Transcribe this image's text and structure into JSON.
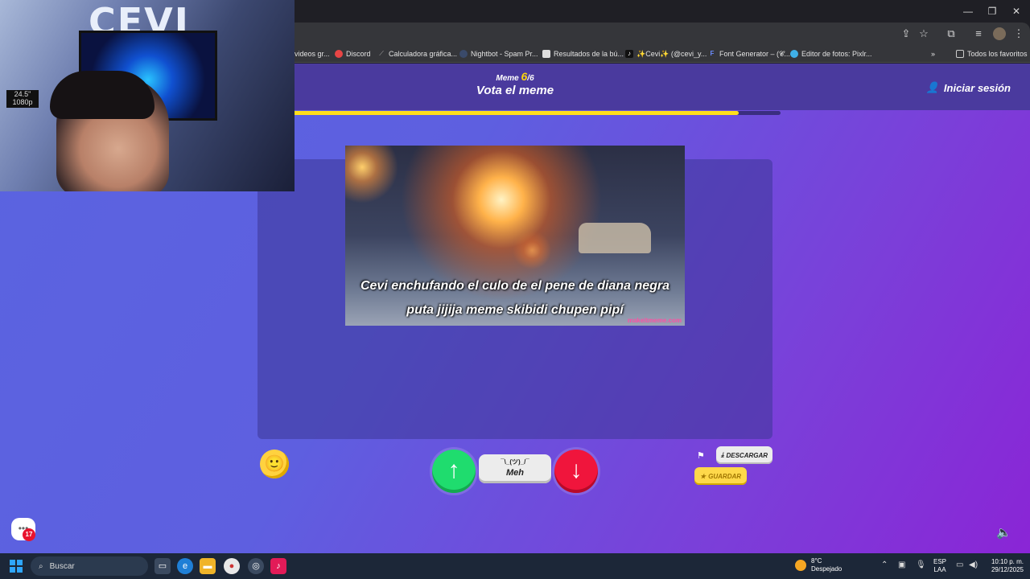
{
  "window": {
    "minimize": "—",
    "restore": "❐",
    "close": "✕"
  },
  "bookmarks": [
    {
      "icon": "",
      "label": "videos gr..."
    },
    {
      "icon": "discord-icon",
      "label": "Discord"
    },
    {
      "icon": "calculator-icon",
      "label": "Calculadora gráfica..."
    },
    {
      "icon": "nightbot-icon",
      "label": "Nightbot - Spam Pr..."
    },
    {
      "icon": "search-results-icon",
      "label": "Resultados de la bú..."
    },
    {
      "icon": "tiktok-icon",
      "label": "✨Cevi✨ (@cevi_y..."
    },
    {
      "icon": "font-icon",
      "label": "Font Generator – (𝓒..."
    },
    {
      "icon": "pixlr-icon",
      "label": "Editor de fotos: Pixlr..."
    }
  ],
  "all_bookmarks": "Todos los favoritos",
  "header": {
    "meme_label": "Meme",
    "meme_current": "6",
    "meme_total": "/6",
    "title": "Vota el meme",
    "login": "Iniciar sesión"
  },
  "progress": {
    "value": 0.92,
    "accent": "#ffdf1c"
  },
  "meme": {
    "caption_line1": "Cevi enchufando el culo de el pene de diana negra",
    "caption_line2": "puta jijija meme skibidi chupen pipí",
    "watermark": "makeitmeme.com"
  },
  "actions": {
    "meh_face": "¯\\_(ツ)_/¯",
    "meh_label": "Meh",
    "download": "DESCARGAR",
    "save": "GUARDAR",
    "chat_badge": "17"
  },
  "webcam": {
    "logo": "CEVI",
    "sticker": "24.5\" 1080p"
  },
  "taskbar": {
    "search_placeholder": "Buscar",
    "weather_temp": "8°C",
    "weather_desc": "Despejado",
    "lang_line1": "ESP",
    "lang_line2": "LAA",
    "time": "10:10 p. m.",
    "date": "29/12/2025"
  },
  "colors": {
    "upvote": "#1fdc6e",
    "downvote": "#f0153c",
    "save": "#ffd84a",
    "header_bg": "#4a3a9e"
  }
}
